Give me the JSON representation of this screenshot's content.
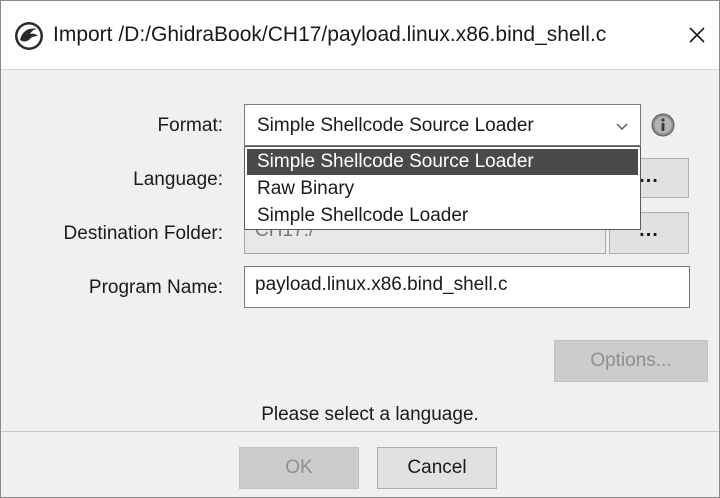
{
  "window": {
    "title": "Import /D:/GhidraBook/CH17/payload.linux.x86.bind_shell.c",
    "close_glyph": "✕"
  },
  "form": {
    "format": {
      "label": "Format:",
      "value": "Simple Shellcode Source Loader",
      "options": [
        "Simple Shellcode Source Loader",
        "Raw Binary",
        "Simple Shellcode Loader"
      ],
      "selected_index": 0,
      "info_icon": "info-icon"
    },
    "language": {
      "label": "Language:",
      "value": "",
      "browse_label": "..."
    },
    "destination_folder": {
      "label": "Destination Folder:",
      "value": "CH17:/",
      "browse_label": "..."
    },
    "program_name": {
      "label": "Program Name:",
      "value": "payload.linux.x86.bind_shell.c"
    },
    "options_button": "Options..."
  },
  "status": {
    "message": "Please select a language."
  },
  "footer": {
    "ok_label": "OK",
    "cancel_label": "Cancel"
  },
  "colors": {
    "selection_background": "#4a4a4a",
    "dialog_background": "#f0f0f0",
    "disabled_button": "#cccccc"
  }
}
